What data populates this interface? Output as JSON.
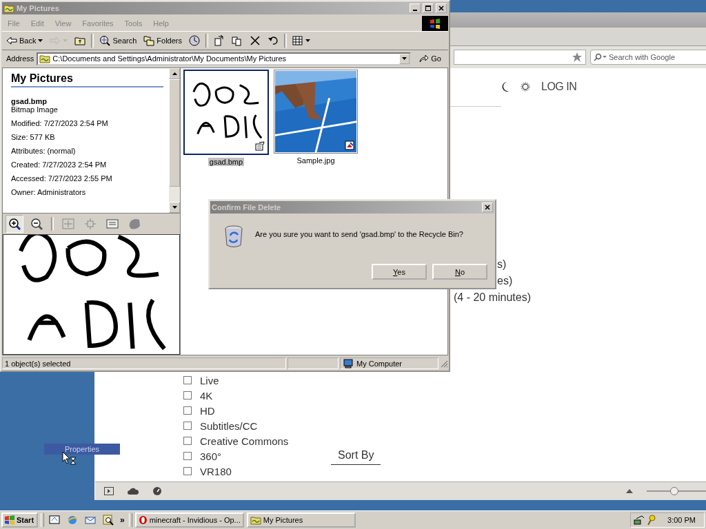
{
  "browser": {
    "search_placeholder": "Search with Google",
    "login": "LOG IN",
    "filter_fragments": [
      "s)",
      "es)",
      "(4 - 20 minutes)"
    ],
    "features": [
      {
        "label": "Live",
        "checked": false
      },
      {
        "label": "4K",
        "checked": false
      },
      {
        "label": "HD",
        "checked": false
      },
      {
        "label": "Subtitles/CC",
        "checked": false
      },
      {
        "label": "Creative Commons",
        "checked": false
      },
      {
        "label": "360°",
        "checked": false
      },
      {
        "label": "VR180",
        "checked": false
      }
    ],
    "sort_by": "Sort By",
    "zoom": {
      "level": 0.4
    }
  },
  "explorer": {
    "title": "My Pictures",
    "active": false,
    "menu": [
      {
        "label": "File",
        "disabled": true
      },
      {
        "label": "Edit",
        "disabled": true
      },
      {
        "label": "View",
        "disabled": true
      },
      {
        "label": "Favorites",
        "disabled": true
      },
      {
        "label": "Tools",
        "disabled": true
      },
      {
        "label": "Help",
        "disabled": true
      }
    ],
    "toolbar": [
      {
        "kind": "back",
        "label": "Back",
        "disabled": false
      },
      {
        "kind": "forward",
        "disabled": true
      },
      {
        "kind": "up",
        "disabled": false
      },
      {
        "kind": "search",
        "label": "Search",
        "disabled": false
      },
      {
        "kind": "folders",
        "label": "Folders",
        "disabled": false
      },
      {
        "kind": "history",
        "disabled": false
      },
      {
        "kind": "move-to",
        "disabled": false
      },
      {
        "kind": "copy-to",
        "disabled": false
      },
      {
        "kind": "delete",
        "disabled": false
      },
      {
        "kind": "undo",
        "disabled": false
      },
      {
        "kind": "views",
        "disabled": false
      }
    ],
    "address": {
      "label": "Address",
      "value": "C:\\Documents and Settings\\Administrator\\My Documents\\My Pictures",
      "go": "Go"
    },
    "info": {
      "heading": "My Pictures",
      "file_name": "gsad.bmp",
      "file_type": "Bitmap Image",
      "details": [
        "Modified: 7/27/2023 2:54 PM",
        "Size: 577 KB",
        "Attributes: (normal)",
        "Created: 7/27/2023 2:54 PM",
        "Accessed: 7/27/2023 2:55 PM",
        "Owner: Administrators"
      ]
    },
    "preview_tools": [
      {
        "kind": "zoom-in",
        "selected": true
      },
      {
        "kind": "zoom-out",
        "selected": false
      },
      {
        "kind": "best-fit",
        "selected": false
      },
      {
        "kind": "actual-size",
        "selected": false
      },
      {
        "kind": "slideshow",
        "selected": false
      },
      {
        "kind": "rotate",
        "selected": false
      }
    ],
    "files": [
      {
        "name": "gsad.bmp",
        "kind": "bitmap",
        "selected": true
      },
      {
        "name": "Sample.jpg",
        "selected": false
      }
    ],
    "status": {
      "text": "1 object(s) selected",
      "zone": "My Computer"
    }
  },
  "dialog": {
    "title": "Confirm File Delete",
    "active": false,
    "message": "Are you sure you want to send 'gsad.bmp' to the Recycle Bin?",
    "buttons": [
      "Yes",
      "No"
    ]
  },
  "desktop": {
    "drag_label": "Properties"
  },
  "taskbar": {
    "start": "Start",
    "more": "»",
    "tasks": [
      {
        "label": "minecraft - Invidious - Op...",
        "kind": "browser",
        "selected": false
      },
      {
        "label": "My Pictures",
        "kind": "folder",
        "selected": false
      }
    ],
    "clock": "3:00 PM"
  }
}
